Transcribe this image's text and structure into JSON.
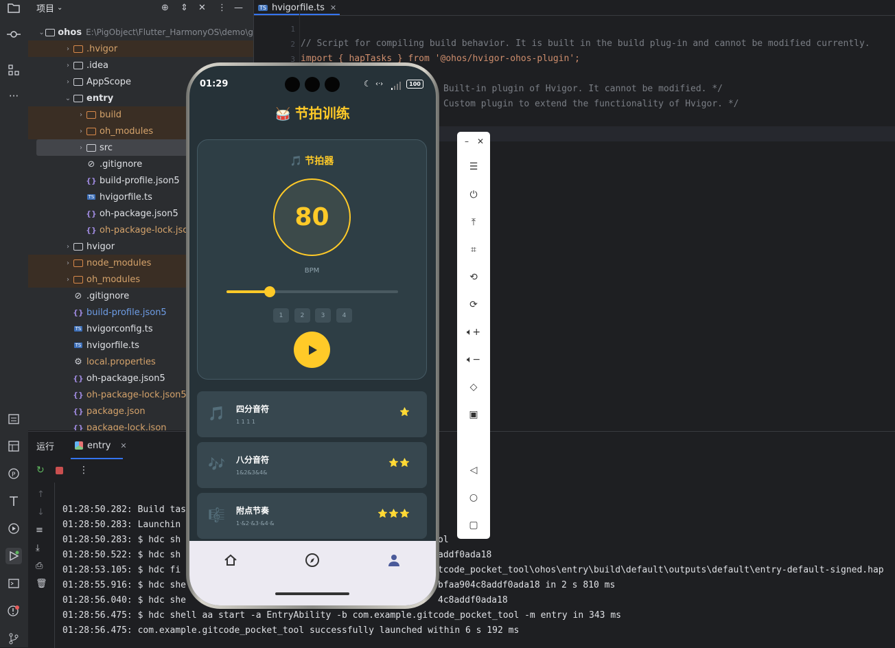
{
  "project_panel": {
    "title": "项目",
    "tree": [
      {
        "label": "ohos",
        "path": "E:\\PigObject\\Flutter_HarmonyOS\\demo\\g",
        "depth": 0,
        "type": "root"
      },
      {
        "label": ".hvigor",
        "depth": 1,
        "type": "folder-excluded"
      },
      {
        "label": ".idea",
        "depth": 1,
        "type": "folder"
      },
      {
        "label": "AppScope",
        "depth": 1,
        "type": "folder"
      },
      {
        "label": "entry",
        "depth": 1,
        "type": "folder-open"
      },
      {
        "label": "build",
        "depth": 2,
        "type": "folder-excluded"
      },
      {
        "label": "oh_modules",
        "depth": 2,
        "type": "folder-excluded"
      },
      {
        "label": "src",
        "depth": 2,
        "type": "folder-selected"
      },
      {
        "label": ".gitignore",
        "depth": 2,
        "type": "ignore"
      },
      {
        "label": "build-profile.json5",
        "depth": 2,
        "type": "json"
      },
      {
        "label": "hvigorfile.ts",
        "depth": 2,
        "type": "ts"
      },
      {
        "label": "oh-package.json5",
        "depth": 2,
        "type": "json"
      },
      {
        "label": "oh-package-lock.json5",
        "depth": 2,
        "type": "json-orange"
      },
      {
        "label": "hvigor",
        "depth": 1,
        "type": "folder"
      },
      {
        "label": "node_modules",
        "depth": 1,
        "type": "folder-excluded"
      },
      {
        "label": "oh_modules",
        "depth": 1,
        "type": "folder-excluded"
      },
      {
        "label": ".gitignore",
        "depth": 1,
        "type": "ignore"
      },
      {
        "label": "build-profile.json5",
        "depth": 1,
        "type": "json-blue"
      },
      {
        "label": "hvigorconfig.ts",
        "depth": 1,
        "type": "ts"
      },
      {
        "label": "hvigorfile.ts",
        "depth": 1,
        "type": "ts"
      },
      {
        "label": "local.properties",
        "depth": 1,
        "type": "props-orange"
      },
      {
        "label": "oh-package.json5",
        "depth": 1,
        "type": "json"
      },
      {
        "label": "oh-package-lock.json5",
        "depth": 1,
        "type": "json-orange"
      },
      {
        "label": "package.json",
        "depth": 1,
        "type": "json-orange"
      },
      {
        "label": "package-lock.json",
        "depth": 1,
        "type": "json-orange"
      }
    ]
  },
  "editor": {
    "tab": "hvigorfile.ts",
    "line_numbers": [
      "1",
      "2",
      "3"
    ],
    "lines": [
      "// Script for compiling build behavior. It is built in the build plug-in and cannot be modified currently.",
      "import { hapTasks } from '@ohos/hvigor-ohos-plugin';",
      "Built-in plugin of Hvigor. It cannot be modified. */",
      "Custom plugin to extend the functionality of Hvigor. */"
    ]
  },
  "run_panel": {
    "title": "运行",
    "config_tab": "entry",
    "log": [
      "01:28:50.282: Build tas",
      "01:28:50.283: Launchin",
      "01:28:50.283: $ hdc sh",
      "01:28:50.522: $ hdc sh",
      "01:28:53.105: $ hdc fi",
      "01:28:55.916: $ hdc she",
      "01:28:56.040: $ hdc she",
      "01:28:56.475: $ hdc shell aa start -a EntryAbility -b com.example.gitcode_pocket_tool -m entry in 343 ms",
      "01:28:56.475: com.example.gitcode_pocket_tool successfully launched within 6 s 192 ms"
    ],
    "log_right": [
      {
        "row": 2,
        "text": "ol"
      },
      {
        "row": 3,
        "text": "addf0ada18"
      },
      {
        "row": 4,
        "text": "tcode_pocket_tool\\ohos\\entry\\build\\default\\outputs\\default\\entry-default-signed.hap"
      },
      {
        "row": 5,
        "text": "bfaa904c8addf0ada18 in 2 s 810 ms"
      },
      {
        "row": 6,
        "text": "4c8addf0ada18"
      }
    ]
  },
  "phone": {
    "status_time": "01:29",
    "battery": "100",
    "app_title": "节拍训练",
    "title_icon": "drum-icon",
    "metronome": {
      "title": "节拍器",
      "bpm": "80",
      "bpm_label": "BPM",
      "slider_value": 0.25,
      "beats": [
        "1",
        "2",
        "3",
        "4"
      ]
    },
    "exercises": [
      {
        "name": "四分音符",
        "pattern": "1  1  1  1",
        "stars": "⭐"
      },
      {
        "name": "八分音符",
        "pattern": "1&2&3&4&",
        "stars": "⭐⭐"
      },
      {
        "name": "附点节奏",
        "pattern": "1·&2·&3·&4·&",
        "stars": "⭐⭐⭐"
      }
    ],
    "nav": [
      "home-icon",
      "compass-icon",
      "person-icon"
    ]
  },
  "colors": {
    "accent": "#ffca28",
    "app_bg": "#263238",
    "card_bg": "#37474f",
    "ide_bg": "#1e1f22",
    "panel_bg": "#2b2d30"
  }
}
